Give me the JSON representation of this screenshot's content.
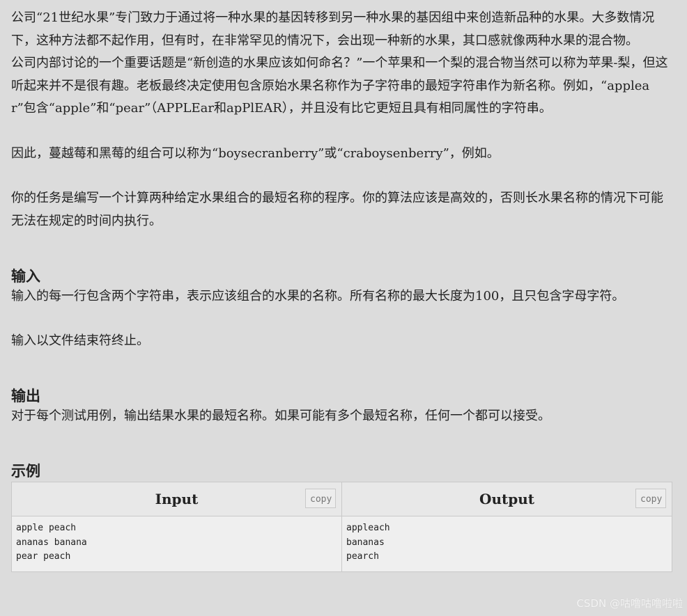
{
  "description": {
    "p1": "公司“21世纪水果”专门致力于通过将一种水果的基因转移到另一种水果的基因组中来创造新品种的水果。大多数情况下，这种方法都不起作用，但有时，在非常罕见的情况下，会出现一种新的水果，其口感就像两种水果的混合物。",
    "p2": "公司内部讨论的一个重要话题是“新创造的水果应该如何命名？”一个苹果和一个梨的混合物当然可以称为苹果-梨，但这听起来并不是很有趣。老板最终决定使用包含原始水果名称作为子字符串的最短字符串作为新名称。例如，“applear”包含“apple”和“pear”（APPLEar和apPlEAR），并且没有比它更短且具有相同属性的字符串。",
    "p3": "因此，蔓越莓和黑莓的组合可以称为“boysecranberry”或“craboysenberry”，例如。",
    "p4": "你的任务是编写一个计算两种给定水果组合的最短名称的程序。你的算法应该是高效的，否则长水果名称的情况下可能无法在规定的时间内执行。"
  },
  "input_section": {
    "title": "输入",
    "line1": "输入的每一行包含两个字符串，表示应该组合的水果的名称。所有名称的最大长度为100，且只包含字母字符。",
    "line2": "输入以文件结束符终止。"
  },
  "output_section": {
    "title": "输出",
    "line1": "对于每个测试用例，输出结果水果的最短名称。如果可能有多个最短名称，任何一个都可以接受。"
  },
  "examples": {
    "title": "示例",
    "input_header": "Input",
    "output_header": "Output",
    "copy_label": "copy",
    "input_text": "apple peach\nananas banana\npear peach",
    "output_text": "appleach\nbananas\npearch"
  },
  "watermark": "CSDN @咕噜咕噜啦啦"
}
